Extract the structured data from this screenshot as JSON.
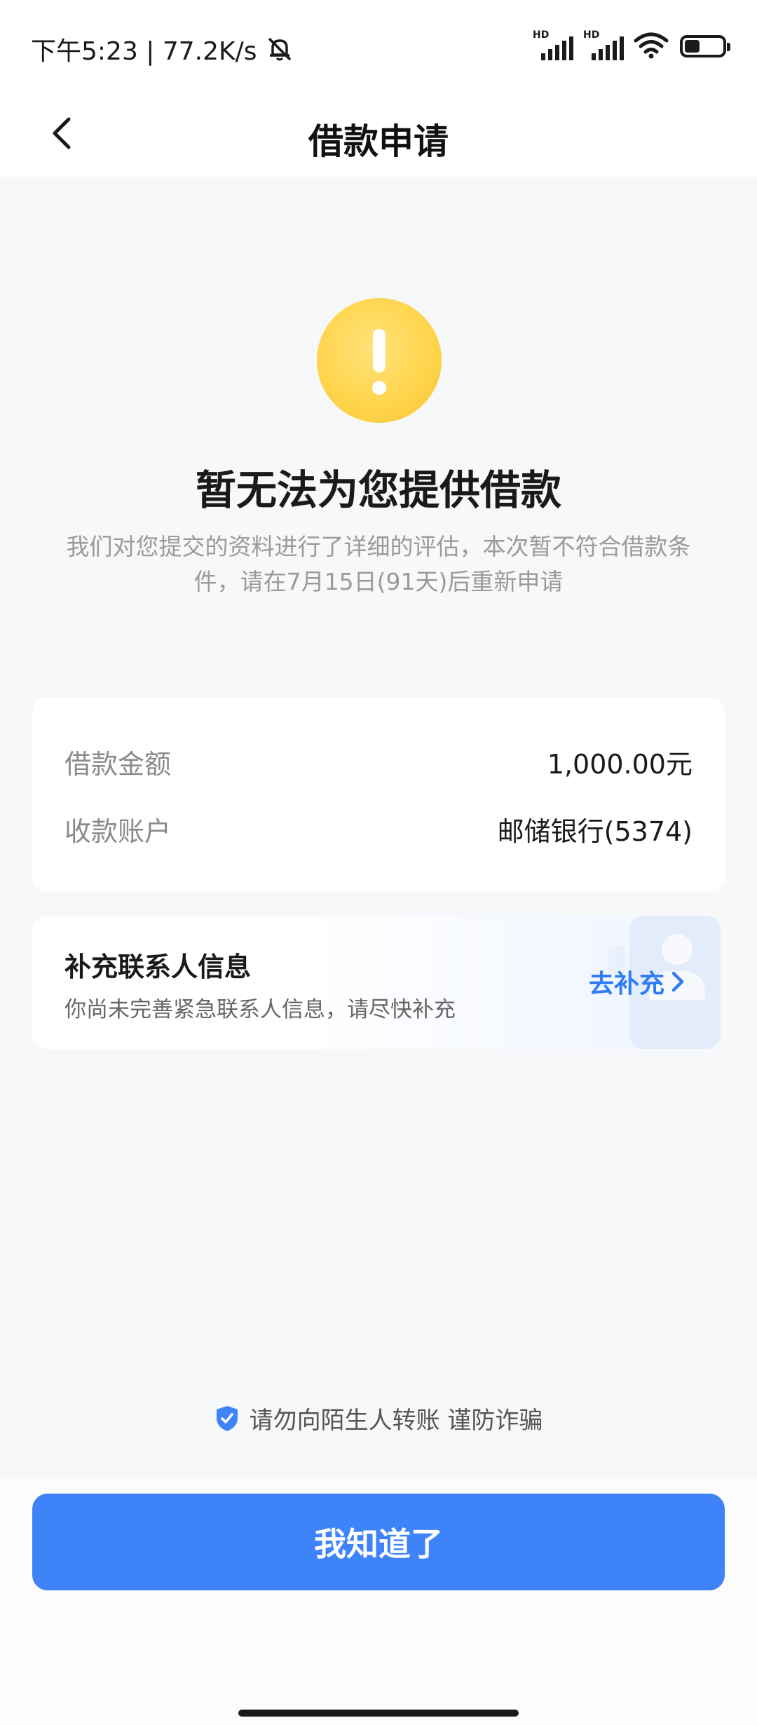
{
  "status_bar": {
    "time_speed": "下午5:23 | 77.2K/s",
    "signal1_label": "HD",
    "signal2_label": "HD"
  },
  "nav": {
    "title": "借款申请"
  },
  "result": {
    "title": "暂无法为您提供借款",
    "description": "我们对您提交的资料进行了详细的评估，本次暂不符合借款条件，请在7月15日(91天)后重新申请"
  },
  "info": {
    "amount_label": "借款金额",
    "amount_value": "1,000.00元",
    "account_label": "收款账户",
    "account_value": "邮储银行(5374)"
  },
  "contact": {
    "title": "补充联系人信息",
    "subtitle": "你尚未完善紧急联系人信息，请尽快补充",
    "action": "去补充"
  },
  "fraud_tip": "请勿向陌生人转账 谨防诈骗",
  "button": {
    "confirm_label": "我知道了"
  },
  "colors": {
    "primary": "#3e83f8",
    "link": "#2f7cf6",
    "warning": "#ffd54d"
  }
}
